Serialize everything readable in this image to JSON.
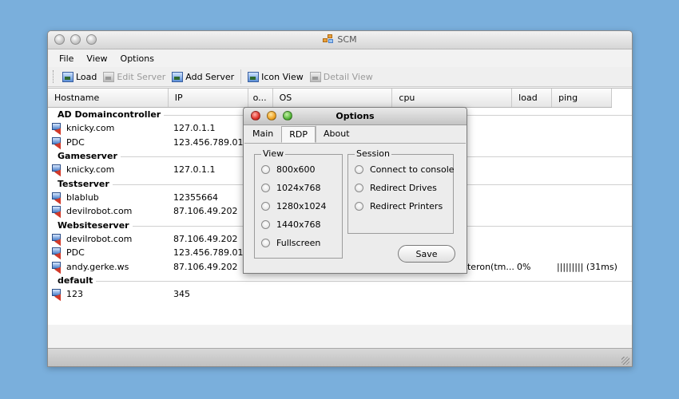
{
  "window": {
    "title": "SCM"
  },
  "menu": [
    "File",
    "View",
    "Options"
  ],
  "toolbar": {
    "load": "Load",
    "edit_server": "Edit Server",
    "add_server": "Add Server",
    "icon_view": "Icon View",
    "detail_view": "Detail View"
  },
  "columns": [
    "Hostname",
    "IP",
    "o...",
    "OS",
    "cpu",
    "load",
    "ping"
  ],
  "groups": [
    {
      "name": "AD Domaincontroller",
      "rows": [
        {
          "host": "knicky.com",
          "ip": "127.0.1.1"
        },
        {
          "host": "PDC",
          "ip": "123.456.789.012"
        }
      ]
    },
    {
      "name": "Gameserver",
      "rows": [
        {
          "host": "knicky.com",
          "ip": "127.0.1.1"
        }
      ]
    },
    {
      "name": "Testserver",
      "rows": [
        {
          "host": "blablub",
          "ip": "12355664"
        },
        {
          "host": "devilrobot.com",
          "ip": "87.106.49.202"
        }
      ]
    },
    {
      "name": "Websiteserver",
      "rows": [
        {
          "host": "devilrobot.com",
          "ip": "87.106.49.202"
        },
        {
          "host": "PDC",
          "ip": "123.456.789.012"
        },
        {
          "host": "andy.gerke.ws",
          "ip": "87.106.49.202",
          "cpu": "pteron(tm...",
          "load": "0%",
          "ping": "||||||||| (31ms)"
        }
      ]
    },
    {
      "name": "default",
      "rows": [
        {
          "host": "123",
          "ip": "345"
        }
      ]
    }
  ],
  "dialog": {
    "title": "Options",
    "tabs": [
      "Main",
      "RDP",
      "About"
    ],
    "active_tab": "RDP",
    "view_legend": "View",
    "view_options": [
      "800x600",
      "1024x768",
      "1280x1024",
      "1440x768",
      "Fullscreen"
    ],
    "session_legend": "Session",
    "session_options": [
      "Connect to console",
      "Redirect Drives",
      "Redirect Printers"
    ],
    "save_label": "Save"
  }
}
